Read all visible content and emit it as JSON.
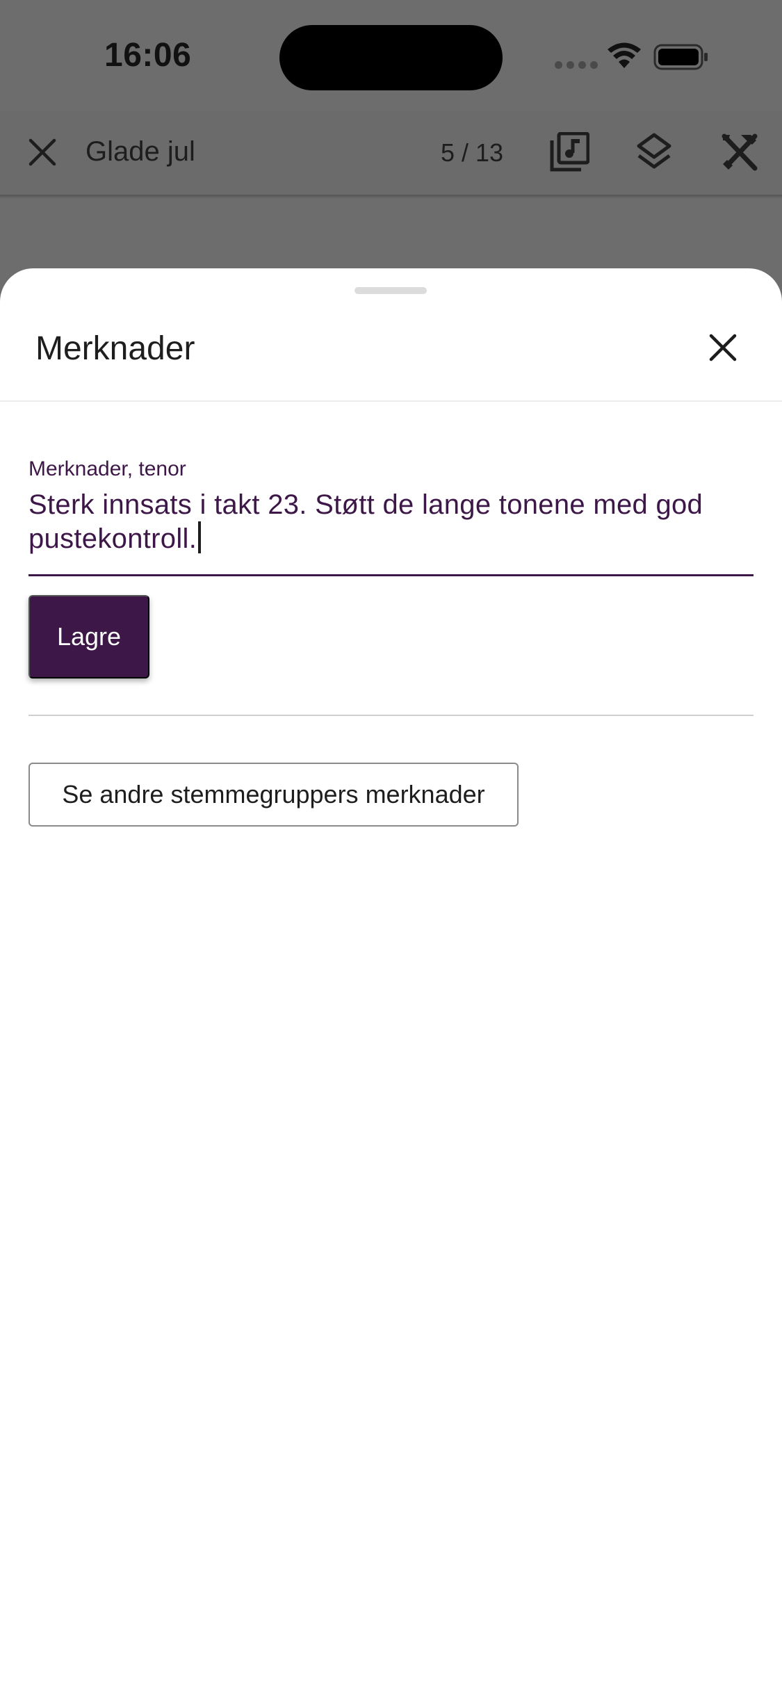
{
  "status_bar": {
    "time": "16:06"
  },
  "app_bar": {
    "title": "Glade jul",
    "page_counter": "5 / 13"
  },
  "icons": {
    "close_app": "close-icon",
    "music_library": "music-library-icon",
    "layers": "layers-icon",
    "tools": "tools-icon",
    "sheet_close": "close-icon"
  },
  "sheet": {
    "title": "Merknader",
    "field": {
      "label": "Merknader, tenor",
      "value": "Sterk innsats i takt 23. Støtt de lange tonene med god pustekontroll."
    },
    "save_label": "Lagre",
    "other_notes_label": "Se andre stemmegruppers merknader"
  },
  "colors": {
    "accent": "#3d1747",
    "backdrop": "#6d6d6d",
    "divider": "#cfcfcf"
  }
}
